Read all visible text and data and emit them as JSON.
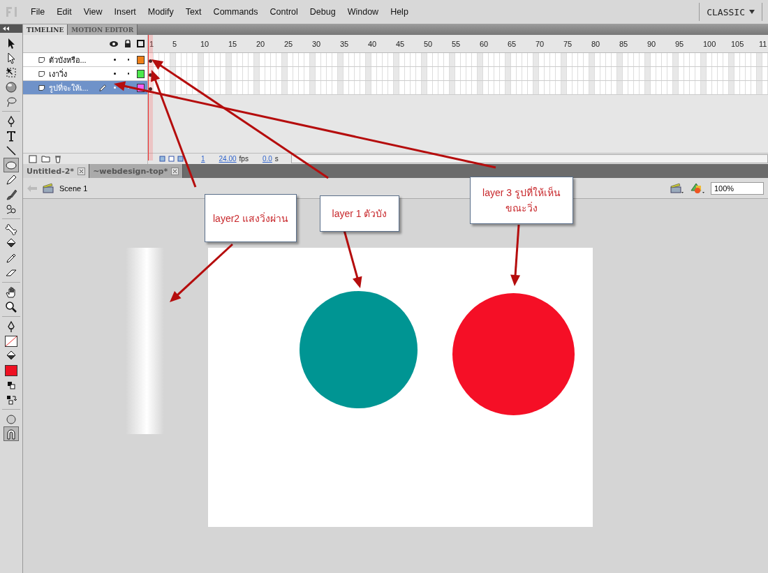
{
  "menu": {
    "items": [
      "File",
      "Edit",
      "View",
      "Insert",
      "Modify",
      "Text",
      "Commands",
      "Control",
      "Debug",
      "Window",
      "Help"
    ],
    "workspace": "CLASSIC"
  },
  "tools": [
    {
      "kind": "arrow",
      "selected": false
    },
    {
      "kind": "subselect",
      "selected": false
    },
    {
      "kind": "transform",
      "selected": false
    },
    {
      "kind": "sphere",
      "selected": false
    },
    {
      "kind": "lasso",
      "selected": false
    },
    {
      "kind": "sep"
    },
    {
      "kind": "pen",
      "selected": false
    },
    {
      "kind": "text",
      "selected": false
    },
    {
      "kind": "line",
      "selected": false
    },
    {
      "kind": "oval",
      "selected": true
    },
    {
      "kind": "pencil",
      "selected": false
    },
    {
      "kind": "brush",
      "selected": false
    },
    {
      "kind": "deco",
      "selected": false
    },
    {
      "kind": "sep"
    },
    {
      "kind": "bone",
      "selected": false
    },
    {
      "kind": "bucket",
      "selected": false
    },
    {
      "kind": "dropper",
      "selected": false
    },
    {
      "kind": "eraser",
      "selected": false
    },
    {
      "kind": "sep"
    },
    {
      "kind": "hand",
      "selected": false
    },
    {
      "kind": "zoom",
      "selected": false
    },
    {
      "kind": "sep"
    },
    {
      "kind": "strokepen",
      "selected": false
    },
    {
      "kind": "strokeswatch",
      "selected": false
    },
    {
      "kind": "fillbucket",
      "selected": false
    },
    {
      "kind": "fillswatch",
      "selected": false
    },
    {
      "kind": "bw",
      "selected": false
    },
    {
      "kind": "swap",
      "selected": false
    },
    {
      "kind": "sep"
    },
    {
      "kind": "objdraw",
      "selected": false
    },
    {
      "kind": "snap",
      "selected": true
    }
  ],
  "timeline": {
    "tabs": [
      {
        "label": "TIMELINE",
        "selected": true
      },
      {
        "label": "MOTION EDITOR",
        "selected": false
      }
    ],
    "frame_numbers": [
      "1",
      "5",
      "10",
      "15",
      "20",
      "25",
      "30",
      "35",
      "40",
      "45",
      "50",
      "55",
      "60",
      "65",
      "70",
      "75",
      "80",
      "85",
      "90",
      "95",
      "100",
      "105",
      "11"
    ],
    "layers": [
      {
        "name": "ตัวบังหรือ...",
        "selected": false,
        "editing": false,
        "color": "#f08018"
      },
      {
        "name": "เงาวิ่ง",
        "selected": false,
        "editing": false,
        "color": "#4ce84c"
      },
      {
        "name": "รูปที่จะให้เ...",
        "selected": true,
        "editing": true,
        "color": "#f55cf5"
      }
    ],
    "footer": {
      "frame": "1",
      "fps": "24.00",
      "fps_unit": "fps",
      "time": "0.0",
      "time_unit": "s"
    }
  },
  "documents": [
    {
      "label": "Untitled-2*",
      "selected": true
    },
    {
      "label": "~webdesign-top*",
      "selected": false
    }
  ],
  "scene": {
    "label": "Scene 1",
    "zoom": "100%"
  },
  "callouts": [
    {
      "text": "layer2 แสงวิ่งผ่าน"
    },
    {
      "text": "layer 1 ตัวบัง"
    },
    {
      "text": "layer 3 รูปที่ให้เห็น ขณะวิ่ง"
    }
  ]
}
